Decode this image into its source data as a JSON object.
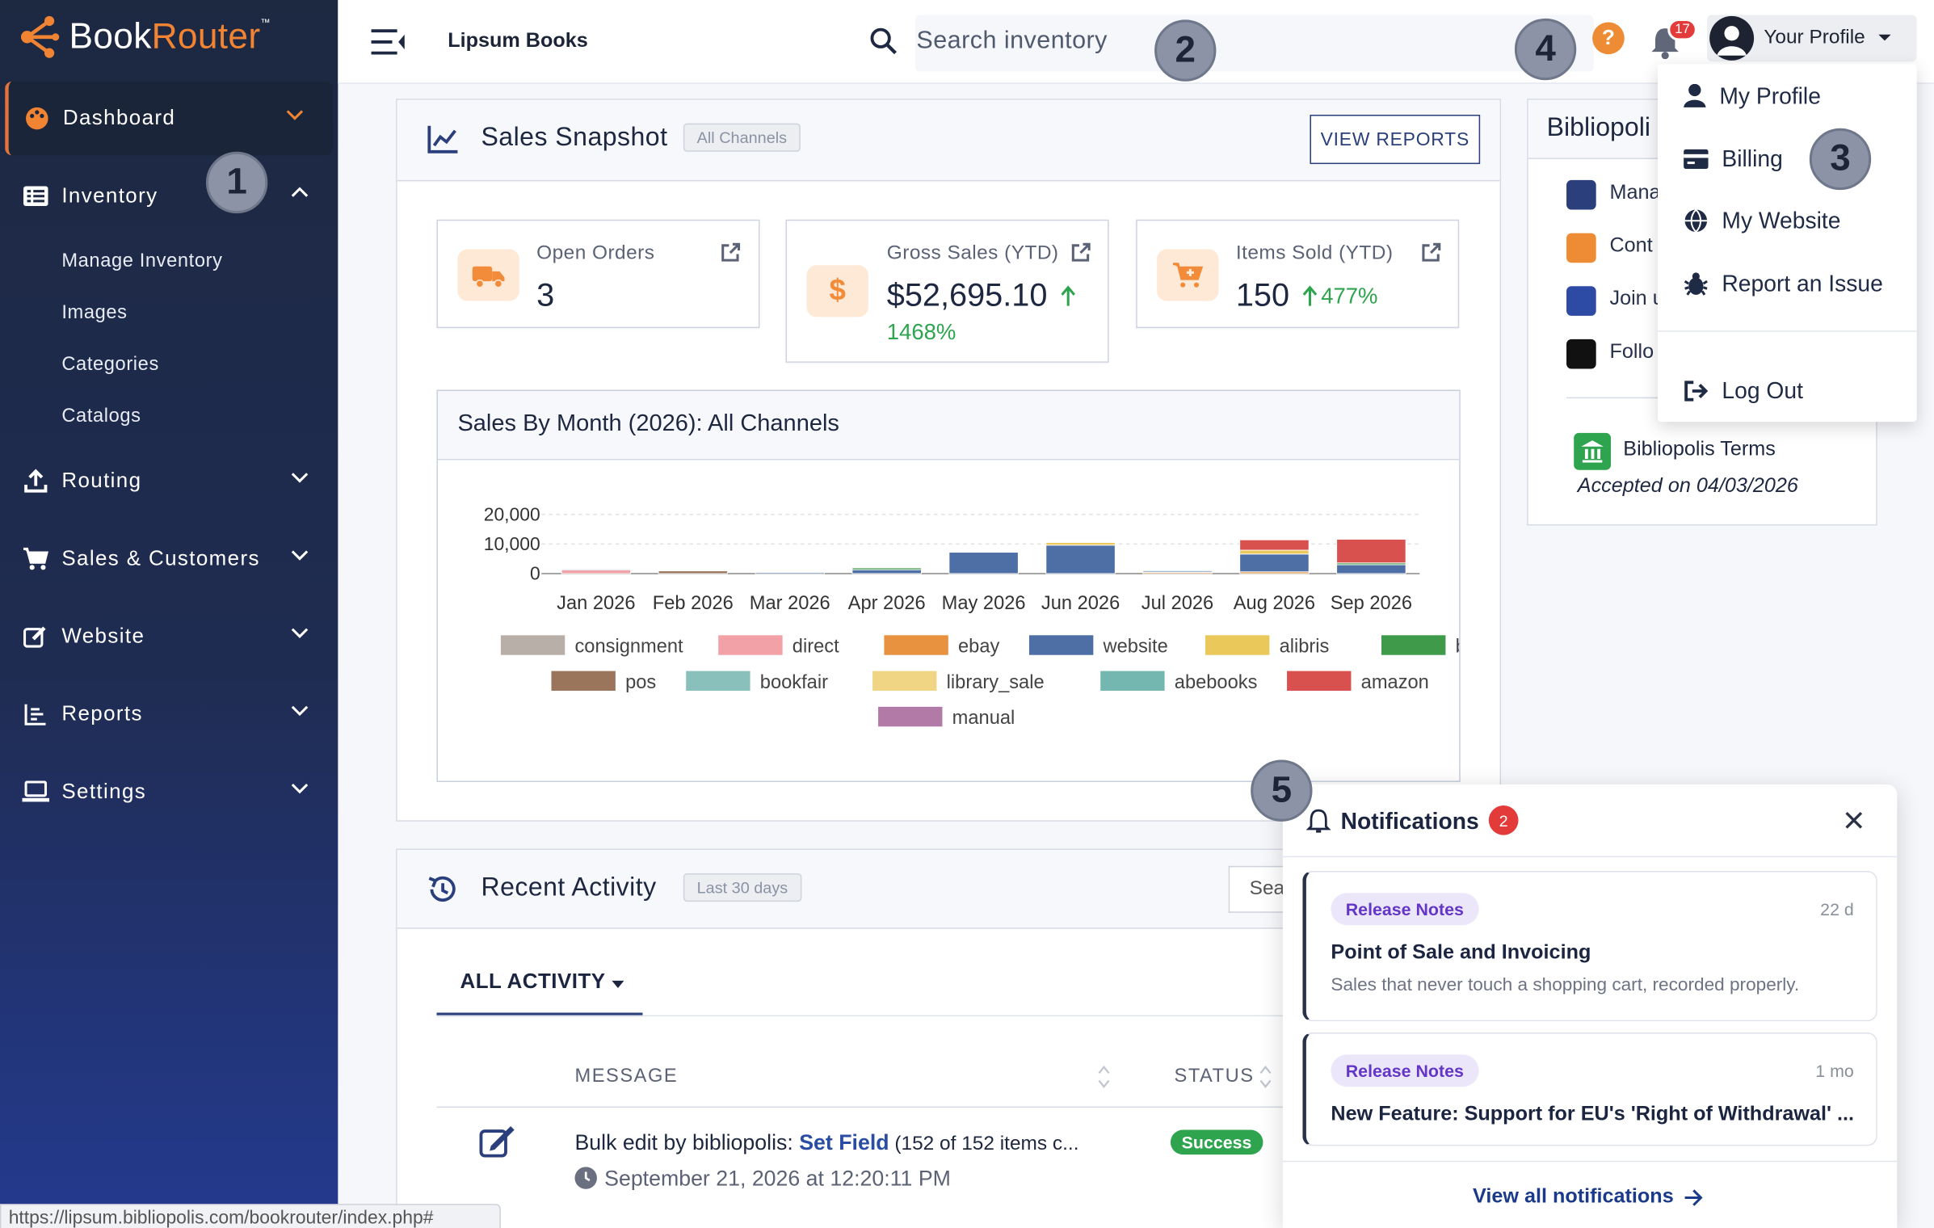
{
  "brand": {
    "name_a": "Book",
    "name_b": "Router",
    "tm": "™"
  },
  "sidebar": {
    "items": [
      {
        "label": "Dashboard"
      },
      {
        "label": "Inventory"
      },
      {
        "label": "Routing"
      },
      {
        "label": "Sales & Customers"
      },
      {
        "label": "Website"
      },
      {
        "label": "Reports"
      },
      {
        "label": "Settings"
      }
    ],
    "inventory_sub": [
      "Manage Inventory",
      "Images",
      "Categories",
      "Catalogs"
    ]
  },
  "header": {
    "store": "Lipsum Books",
    "search_placeholder": "Search inventory",
    "help": "?",
    "bell_count": "17",
    "profile": "Your Profile"
  },
  "callouts": [
    "1",
    "2",
    "3",
    "4",
    "5"
  ],
  "profile_menu": {
    "items": [
      "My Profile",
      "Billing",
      "My Website",
      "Report an Issue"
    ],
    "logout": "Log Out"
  },
  "snapshot": {
    "title": "Sales Snapshot",
    "pill": "All Channels",
    "button": "VIEW REPORTS",
    "stats": [
      {
        "label": "Open Orders",
        "value": "3",
        "change": ""
      },
      {
        "label": "Gross Sales (YTD)",
        "value": "$52,695.10",
        "change": "1468%"
      },
      {
        "label": "Items Sold (YTD)",
        "value": "150",
        "change": "477%"
      }
    ]
  },
  "side_panel": {
    "title": "Bibliopoli",
    "links": [
      "Mana",
      "Cont",
      "Join u",
      "Follo"
    ],
    "terms_title": "Bibliopolis Terms",
    "terms_sub": "Accepted on 04/03/2026"
  },
  "chart_data": {
    "type": "bar",
    "title": "Sales By Month (2026): All Channels",
    "stacked": true,
    "categories": [
      "Jan 2026",
      "Feb 2026",
      "Mar 2026",
      "Apr 2026",
      "May 2026",
      "Jun 2026",
      "Jul 2026",
      "Aug 2026",
      "Sep 2026"
    ],
    "y_ticks": [
      "20,000",
      "10,000",
      "0"
    ],
    "ylim": [
      0,
      22000
    ],
    "series": [
      {
        "name": "consignment",
        "color": "#b9afa9",
        "values": [
          0,
          0,
          0,
          0,
          0,
          0,
          0,
          0,
          0
        ]
      },
      {
        "name": "direct",
        "color": "#f2a1a6",
        "values": [
          1200,
          0,
          0,
          0,
          0,
          0,
          0,
          0,
          0
        ]
      },
      {
        "name": "ebay",
        "color": "#e8913f",
        "values": [
          0,
          0,
          0,
          0,
          0,
          0,
          400,
          600,
          0
        ]
      },
      {
        "name": "website",
        "color": "#4d6fa6",
        "values": [
          300,
          0,
          400,
          1300,
          7200,
          9600,
          400,
          6000,
          3000
        ]
      },
      {
        "name": "alibris",
        "color": "#eac85a",
        "values": [
          0,
          0,
          0,
          0,
          0,
          900,
          0,
          1300,
          0
        ]
      },
      {
        "name": "biblio",
        "color": "#3f9a4a",
        "values": [
          0,
          0,
          0,
          600,
          0,
          0,
          0,
          0,
          600
        ]
      },
      {
        "name": "pos",
        "color": "#9b755b",
        "values": [
          0,
          900,
          0,
          0,
          0,
          0,
          0,
          0,
          0
        ]
      },
      {
        "name": "bookfair",
        "color": "#8ac0bc",
        "values": [
          0,
          0,
          0,
          0,
          0,
          0,
          0,
          0,
          0
        ]
      },
      {
        "name": "library_sale",
        "color": "#f0d585",
        "values": [
          0,
          0,
          0,
          0,
          0,
          0,
          0,
          0,
          0
        ]
      },
      {
        "name": "abebooks",
        "color": "#74b7b0",
        "values": [
          0,
          0,
          0,
          0,
          0,
          0,
          300,
          0,
          0
        ]
      },
      {
        "name": "amazon",
        "color": "#d9514f",
        "values": [
          0,
          0,
          0,
          0,
          0,
          0,
          0,
          3500,
          8000
        ]
      },
      {
        "name": "manual",
        "color": "#b27aa7",
        "values": [
          0,
          0,
          0,
          0,
          0,
          0,
          0,
          0,
          0
        ]
      }
    ],
    "legend": "bottom"
  },
  "activity": {
    "title": "Recent Activity",
    "pill": "Last 30 days",
    "search": "Sea",
    "tab": "ALL ACTIVITY",
    "col_message": "MESSAGE",
    "col_status": "STATUS",
    "row": {
      "prefix": "Bulk edit by bibliopolis: ",
      "link": "Set Field",
      "suffix": " (152 of 152 items c...",
      "date": "September 21, 2026 at 12:20:11 PM",
      "status": "Success"
    }
  },
  "notifications": {
    "title": "Notifications",
    "count": "2",
    "items": [
      {
        "tag": "Release Notes",
        "time": "22 d",
        "title": "Point of Sale and Invoicing",
        "body": "Sales that never touch a shopping cart, recorded properly."
      },
      {
        "tag": "Release Notes",
        "time": "1 mo",
        "title": "New Feature: Support for EU's 'Right of Withdrawal' ...",
        "body": ""
      }
    ],
    "view_all": "View all notifications"
  },
  "status_url": "https://lipsum.bibliopolis.com/bookrouter/index.php#"
}
